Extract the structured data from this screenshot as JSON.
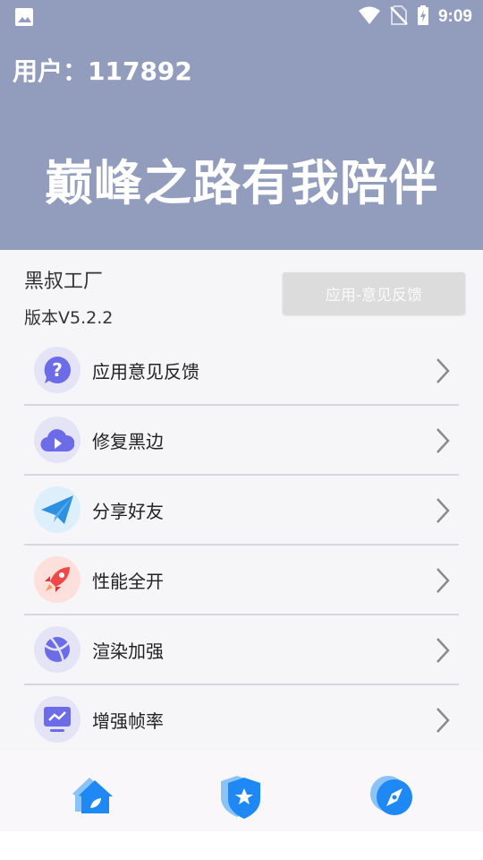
{
  "status_bar": {
    "time": "9:09",
    "icons": [
      "image-icon",
      "wifi-icon",
      "no-sim-icon",
      "battery-charging-icon"
    ]
  },
  "header": {
    "user": "用户：117892",
    "slogan": "巅峰之路有我陪伴"
  },
  "info": {
    "brand": "黑叔工厂",
    "version": "版本V5.2.2",
    "feedback_button": "应用-意见反馈"
  },
  "menu": {
    "items": [
      {
        "label": "应用意见反馈",
        "icon": "question-chat-icon"
      },
      {
        "label": "修复黑边",
        "icon": "cloud-play-icon"
      },
      {
        "label": "分享好友",
        "icon": "paper-plane-icon"
      },
      {
        "label": "性能全开",
        "icon": "rocket-icon"
      },
      {
        "label": "渲染加强",
        "icon": "globe-icon"
      },
      {
        "label": "增强帧率",
        "icon": "monitor-chart-icon"
      }
    ]
  },
  "bottom_nav": {
    "items": [
      "home-icon",
      "shield-star-icon",
      "compass-icon"
    ]
  },
  "colors": {
    "header_bg": "#929cbd",
    "accent_blue": "#1e88f5",
    "rocket_red": "#f04848",
    "icon_purple": "#6c6ce8"
  }
}
